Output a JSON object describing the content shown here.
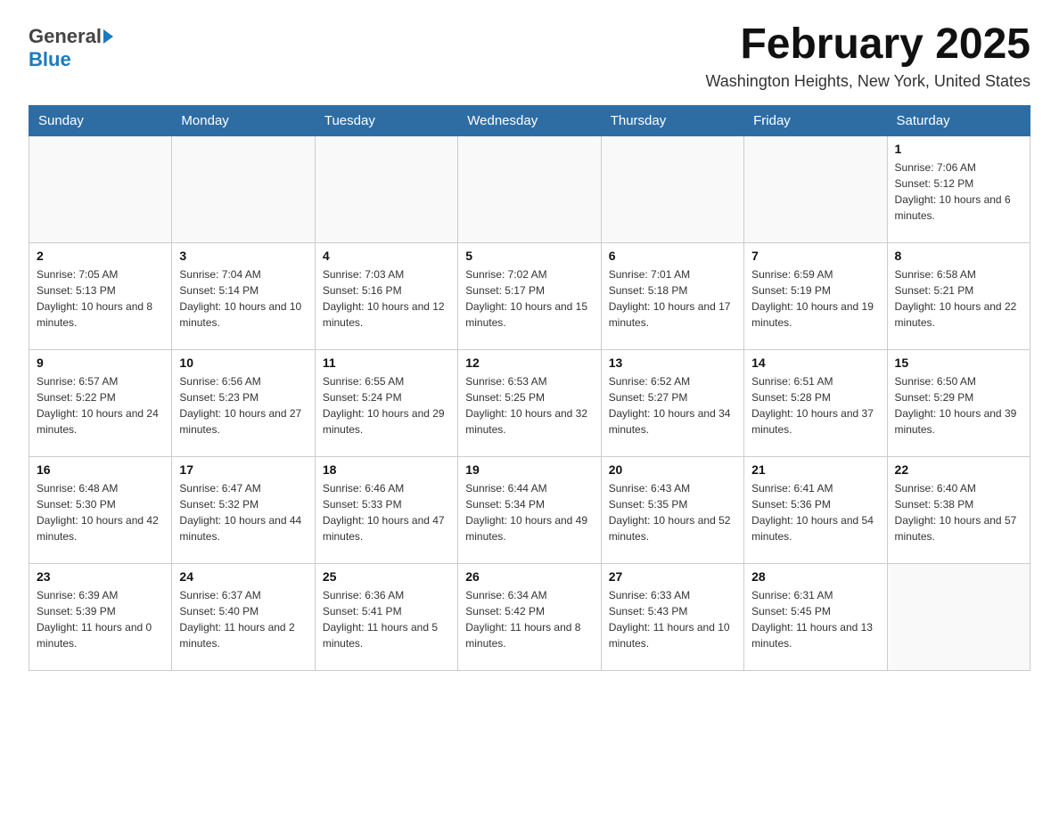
{
  "header": {
    "logo_general": "General",
    "logo_blue": "Blue",
    "month_title": "February 2025",
    "location": "Washington Heights, New York, United States"
  },
  "weekdays": [
    "Sunday",
    "Monday",
    "Tuesday",
    "Wednesday",
    "Thursday",
    "Friday",
    "Saturday"
  ],
  "weeks": [
    [
      {
        "day": "",
        "sunrise": "",
        "sunset": "",
        "daylight": ""
      },
      {
        "day": "",
        "sunrise": "",
        "sunset": "",
        "daylight": ""
      },
      {
        "day": "",
        "sunrise": "",
        "sunset": "",
        "daylight": ""
      },
      {
        "day": "",
        "sunrise": "",
        "sunset": "",
        "daylight": ""
      },
      {
        "day": "",
        "sunrise": "",
        "sunset": "",
        "daylight": ""
      },
      {
        "day": "",
        "sunrise": "",
        "sunset": "",
        "daylight": ""
      },
      {
        "day": "1",
        "sunrise": "Sunrise: 7:06 AM",
        "sunset": "Sunset: 5:12 PM",
        "daylight": "Daylight: 10 hours and 6 minutes."
      }
    ],
    [
      {
        "day": "2",
        "sunrise": "Sunrise: 7:05 AM",
        "sunset": "Sunset: 5:13 PM",
        "daylight": "Daylight: 10 hours and 8 minutes."
      },
      {
        "day": "3",
        "sunrise": "Sunrise: 7:04 AM",
        "sunset": "Sunset: 5:14 PM",
        "daylight": "Daylight: 10 hours and 10 minutes."
      },
      {
        "day": "4",
        "sunrise": "Sunrise: 7:03 AM",
        "sunset": "Sunset: 5:16 PM",
        "daylight": "Daylight: 10 hours and 12 minutes."
      },
      {
        "day": "5",
        "sunrise": "Sunrise: 7:02 AM",
        "sunset": "Sunset: 5:17 PM",
        "daylight": "Daylight: 10 hours and 15 minutes."
      },
      {
        "day": "6",
        "sunrise": "Sunrise: 7:01 AM",
        "sunset": "Sunset: 5:18 PM",
        "daylight": "Daylight: 10 hours and 17 minutes."
      },
      {
        "day": "7",
        "sunrise": "Sunrise: 6:59 AM",
        "sunset": "Sunset: 5:19 PM",
        "daylight": "Daylight: 10 hours and 19 minutes."
      },
      {
        "day": "8",
        "sunrise": "Sunrise: 6:58 AM",
        "sunset": "Sunset: 5:21 PM",
        "daylight": "Daylight: 10 hours and 22 minutes."
      }
    ],
    [
      {
        "day": "9",
        "sunrise": "Sunrise: 6:57 AM",
        "sunset": "Sunset: 5:22 PM",
        "daylight": "Daylight: 10 hours and 24 minutes."
      },
      {
        "day": "10",
        "sunrise": "Sunrise: 6:56 AM",
        "sunset": "Sunset: 5:23 PM",
        "daylight": "Daylight: 10 hours and 27 minutes."
      },
      {
        "day": "11",
        "sunrise": "Sunrise: 6:55 AM",
        "sunset": "Sunset: 5:24 PM",
        "daylight": "Daylight: 10 hours and 29 minutes."
      },
      {
        "day": "12",
        "sunrise": "Sunrise: 6:53 AM",
        "sunset": "Sunset: 5:25 PM",
        "daylight": "Daylight: 10 hours and 32 minutes."
      },
      {
        "day": "13",
        "sunrise": "Sunrise: 6:52 AM",
        "sunset": "Sunset: 5:27 PM",
        "daylight": "Daylight: 10 hours and 34 minutes."
      },
      {
        "day": "14",
        "sunrise": "Sunrise: 6:51 AM",
        "sunset": "Sunset: 5:28 PM",
        "daylight": "Daylight: 10 hours and 37 minutes."
      },
      {
        "day": "15",
        "sunrise": "Sunrise: 6:50 AM",
        "sunset": "Sunset: 5:29 PM",
        "daylight": "Daylight: 10 hours and 39 minutes."
      }
    ],
    [
      {
        "day": "16",
        "sunrise": "Sunrise: 6:48 AM",
        "sunset": "Sunset: 5:30 PM",
        "daylight": "Daylight: 10 hours and 42 minutes."
      },
      {
        "day": "17",
        "sunrise": "Sunrise: 6:47 AM",
        "sunset": "Sunset: 5:32 PM",
        "daylight": "Daylight: 10 hours and 44 minutes."
      },
      {
        "day": "18",
        "sunrise": "Sunrise: 6:46 AM",
        "sunset": "Sunset: 5:33 PM",
        "daylight": "Daylight: 10 hours and 47 minutes."
      },
      {
        "day": "19",
        "sunrise": "Sunrise: 6:44 AM",
        "sunset": "Sunset: 5:34 PM",
        "daylight": "Daylight: 10 hours and 49 minutes."
      },
      {
        "day": "20",
        "sunrise": "Sunrise: 6:43 AM",
        "sunset": "Sunset: 5:35 PM",
        "daylight": "Daylight: 10 hours and 52 minutes."
      },
      {
        "day": "21",
        "sunrise": "Sunrise: 6:41 AM",
        "sunset": "Sunset: 5:36 PM",
        "daylight": "Daylight: 10 hours and 54 minutes."
      },
      {
        "day": "22",
        "sunrise": "Sunrise: 6:40 AM",
        "sunset": "Sunset: 5:38 PM",
        "daylight": "Daylight: 10 hours and 57 minutes."
      }
    ],
    [
      {
        "day": "23",
        "sunrise": "Sunrise: 6:39 AM",
        "sunset": "Sunset: 5:39 PM",
        "daylight": "Daylight: 11 hours and 0 minutes."
      },
      {
        "day": "24",
        "sunrise": "Sunrise: 6:37 AM",
        "sunset": "Sunset: 5:40 PM",
        "daylight": "Daylight: 11 hours and 2 minutes."
      },
      {
        "day": "25",
        "sunrise": "Sunrise: 6:36 AM",
        "sunset": "Sunset: 5:41 PM",
        "daylight": "Daylight: 11 hours and 5 minutes."
      },
      {
        "day": "26",
        "sunrise": "Sunrise: 6:34 AM",
        "sunset": "Sunset: 5:42 PM",
        "daylight": "Daylight: 11 hours and 8 minutes."
      },
      {
        "day": "27",
        "sunrise": "Sunrise: 6:33 AM",
        "sunset": "Sunset: 5:43 PM",
        "daylight": "Daylight: 11 hours and 10 minutes."
      },
      {
        "day": "28",
        "sunrise": "Sunrise: 6:31 AM",
        "sunset": "Sunset: 5:45 PM",
        "daylight": "Daylight: 11 hours and 13 minutes."
      },
      {
        "day": "",
        "sunrise": "",
        "sunset": "",
        "daylight": ""
      }
    ]
  ]
}
